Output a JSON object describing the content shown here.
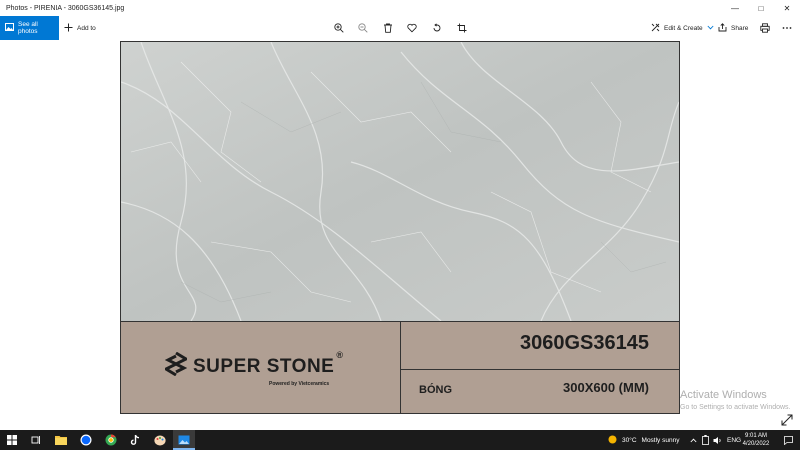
{
  "window": {
    "title": "Photos - PIRENIA - 3060GS36145.jpg",
    "minimize_glyph": "—",
    "maximize_glyph": "□",
    "close_glyph": "✕"
  },
  "toolbar": {
    "see_all_label": "See all photos",
    "add_to_label": "Add to",
    "edit_create_label": "Edit & Create",
    "share_label": "Share"
  },
  "icons": {
    "see_all": "photos-icon",
    "add": "plus-icon",
    "zoom_in": "zoom-in-icon",
    "zoom_out": "zoom-out-icon",
    "delete": "trash-icon",
    "favorite": "heart-icon",
    "rotate": "rotate-icon",
    "crop": "crop-icon",
    "edit": "edit-create-icon",
    "share": "share-icon",
    "print": "printer-icon",
    "more": "more-icon",
    "expand": "expand-icon"
  },
  "product": {
    "brand": "SUPER STONE",
    "registered": "®",
    "tagline": "Powered by Vietceramics",
    "code": "3060GS36145",
    "finish": "BÓNG",
    "size": "300X600 (MM)"
  },
  "watermark": {
    "line1": "Activate Windows",
    "line2": "Go to Settings to activate Windows."
  },
  "taskbar": {
    "weather_temp": "30°C",
    "weather_desc": "Mostly sunny",
    "language": "ENG",
    "time": "9:01 AM",
    "date": "4/20/2022"
  },
  "colors": {
    "accent": "#0078d4",
    "band": "#b09f93",
    "marble": "#c4c8c6",
    "taskbar": "#1b1b1b"
  }
}
